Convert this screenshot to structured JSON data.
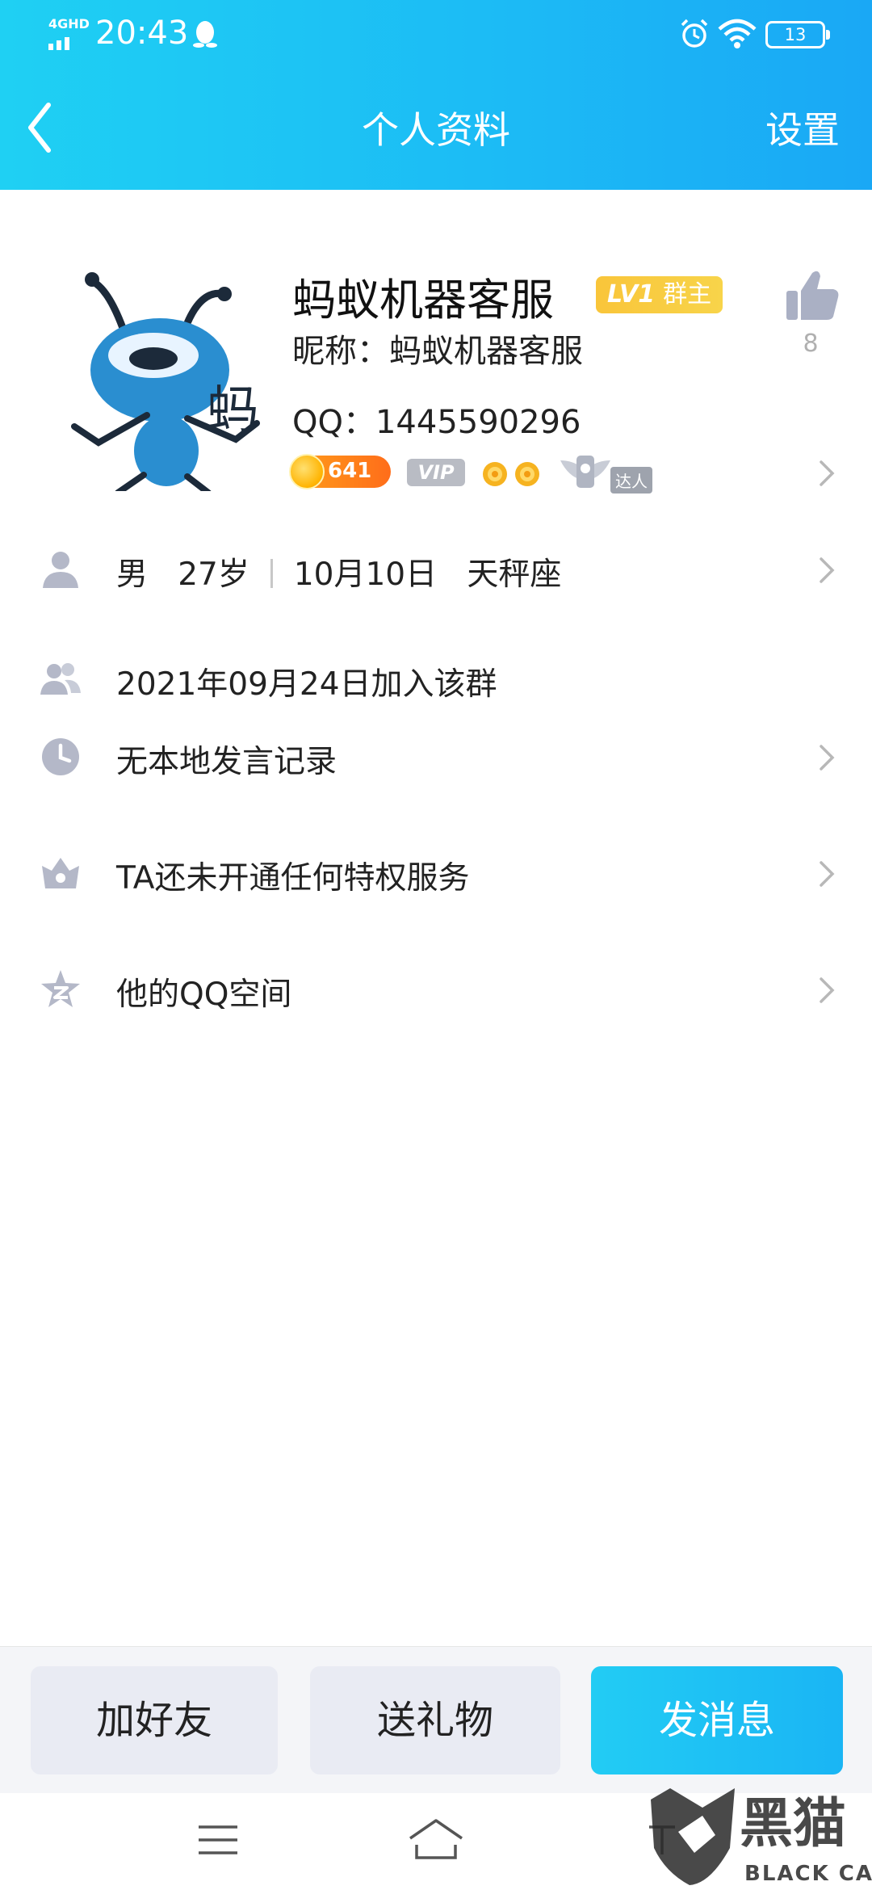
{
  "status_bar": {
    "network": "4GHD",
    "time": "20:43",
    "battery": "13"
  },
  "header": {
    "title": "个人资料",
    "settings_label": "设置"
  },
  "profile": {
    "name": "蚂蚁机器客服",
    "level_label": "LV1",
    "role_label": "群主",
    "nickname": "昵称：蚂蚁机器客服",
    "qq": "QQ：1445590296",
    "likes": "8",
    "coin_count": "641",
    "vip_label": "VIP",
    "talent_label": "达人",
    "avatar_text": "蚂"
  },
  "info": {
    "gender": "男",
    "age": "27岁",
    "birthday": "10月10日",
    "zodiac": "天秤座",
    "join_date": "2021年09月24日加入该群",
    "speech_record": "无本地发言记录",
    "privilege": "TA还未开通任何特权服务",
    "qzone": "他的QQ空间"
  },
  "actions": {
    "add_friend": "加好友",
    "send_gift": "送礼物",
    "send_message": "发消息"
  },
  "watermark": {
    "cn": "黑猫",
    "en": "BLACK CAT"
  },
  "colors": {
    "header_blue": "#1cbcf5",
    "icon_gray": "#b4b8c8",
    "badge_yellow": "#f9c53a"
  }
}
